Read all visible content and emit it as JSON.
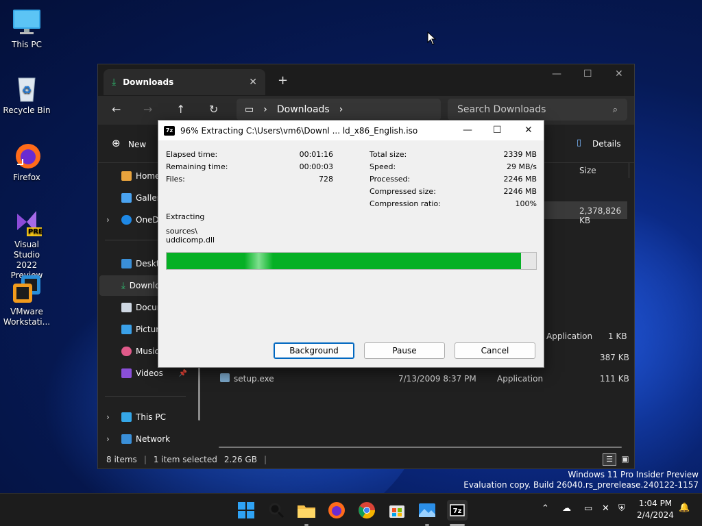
{
  "desktop": {
    "icons": [
      {
        "label": "This PC"
      },
      {
        "label": "Recycle Bin"
      },
      {
        "label": "Firefox"
      },
      {
        "label": "Visual Studio 2022 Preview",
        "badge": "PRE"
      },
      {
        "label": "VMware Workstati..."
      }
    ]
  },
  "explorer": {
    "tab_title": "Downloads",
    "address_segment": "Downloads",
    "search_placeholder": "Search Downloads",
    "new_label": "New",
    "details_label": "Details",
    "column_size": "Size",
    "sidebar": [
      {
        "label": "Home"
      },
      {
        "label": "Gallery"
      },
      {
        "label": "OneDrive"
      },
      {
        "label": "Desktop"
      },
      {
        "label": "Downloads"
      },
      {
        "label": "Documents"
      },
      {
        "label": "Pictures"
      },
      {
        "label": "Music"
      },
      {
        "label": "Videos"
      },
      {
        "label": "This PC"
      },
      {
        "label": "Network"
      }
    ],
    "files": {
      "selected_size": "2,378,826 KB",
      "row1_type": "Application",
      "row1_size": "1 KB",
      "row2_size": "387 KB",
      "row3_name": "setup.exe",
      "row3_date": "7/13/2009 8:37 PM",
      "row3_type": "Application",
      "row3_size": "111 KB"
    },
    "status": {
      "items": "8 items",
      "selected": "1 item selected",
      "size": "2.26 GB"
    }
  },
  "dialog": {
    "title": "96% Extracting C:\\Users\\vm6\\Downl ... ld_x86_English.iso",
    "left_labels": [
      "Elapsed time:",
      "Remaining time:",
      "Files:"
    ],
    "left_values": [
      "00:01:16",
      "00:00:03",
      "728"
    ],
    "right_labels": [
      "Total size:",
      "Speed:",
      "Processed:",
      "Compressed size:",
      "Compression ratio:"
    ],
    "right_values": [
      "2339 MB",
      "29 MB/s",
      "2246 MB",
      "2246 MB",
      "100%"
    ],
    "action": "Extracting",
    "path_line1": "sources\\",
    "path_line2": "uddicomp.dll",
    "progress_percent": 96,
    "buttons": {
      "background": "Background",
      "pause": "Pause",
      "cancel": "Cancel"
    }
  },
  "watermark": {
    "line1": "Windows 11 Pro Insider Preview",
    "line2": "Evaluation copy. Build 26040.rs_prerelease.240122-1157"
  },
  "taskbar": {
    "time": "1:04 PM",
    "date": "2/4/2024"
  }
}
